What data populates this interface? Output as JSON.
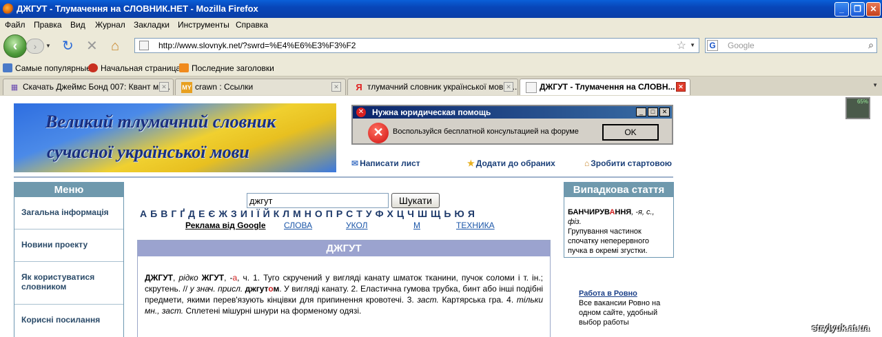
{
  "window": {
    "title": "ДЖГУТ - Тлумачення на СЛОВНИК.НЕТ - Mozilla Firefox"
  },
  "menubar": [
    "Файл",
    "Правка",
    "Вид",
    "Журнал",
    "Закладки",
    "Инструменты",
    "Справка"
  ],
  "navbar": {
    "url": "http://www.slovnyk.net/?swrd=%E4%E6%E3%F3%F2",
    "search_placeholder": "Google"
  },
  "bookmarks": [
    "Самые популярные",
    "Начальная страница",
    "Последние заголовки"
  ],
  "tabs": [
    {
      "label": "Скачать Джеймс Бонд 007: Квант ми..."
    },
    {
      "label": "crawn : Ссылки"
    },
    {
      "label": "тлумачний словник української мови ..."
    },
    {
      "label": "ДЖГУТ - Тлумачення на СЛОВН..."
    }
  ],
  "banner": {
    "line1": "Великий тлумачний словник",
    "line2": "сучасної української мови"
  },
  "ad_dialog": {
    "title": "Нужна юридическая помощь",
    "message": "Воспользуйся бесплатной консультацией на форуме",
    "ok": "OK"
  },
  "actions": [
    "Написати лист",
    "Додати до обраних",
    "Зробити стартовою"
  ],
  "menu": {
    "title": "Меню",
    "items": [
      "Загальна інформація",
      "Новини проекту",
      "Як користуватися словником",
      "Корисні посилання"
    ]
  },
  "search": {
    "value": "джгут",
    "button": "Шукати"
  },
  "alphabet": [
    "А",
    "Б",
    "В",
    "Г",
    "Ґ",
    "Д",
    "Е",
    "Є",
    "Ж",
    "З",
    "И",
    "І",
    "Ї",
    "Й",
    "К",
    "Л",
    "М",
    "Н",
    "О",
    "П",
    "Р",
    "С",
    "Т",
    "У",
    "Ф",
    "Х",
    "Ц",
    "Ч",
    "Ш",
    "Щ",
    "Ь",
    "Ю",
    "Я"
  ],
  "ads": {
    "google": "Реклама від Google",
    "links": [
      "СЛОВА",
      "УКОЛ",
      "М",
      "ТЕХНИКА"
    ]
  },
  "article": {
    "title": "ДЖГУТ",
    "headword": "ДЖГУТ",
    "text_1": ", ",
    "variant_label": "рідко",
    "variant": " ЖГУТ",
    "text_2": ", -",
    "ending_red": "а",
    "text_3": ", ч. 1. Туго скручений у вигляді канату шматок тканини, пучок соломи і т. ін.; скрутень. // ",
    "usage_label": "у знач. присл.",
    "form_pre": " джгут",
    "form_stress": "о",
    "form_post": "м",
    "text_4": ". У вигляді канату. 2. Еластична гумова трубка, бинт або інші подібні предмети, якими перев'язують кінцівки для припинення кровотечі. 3. ",
    "label_3": "заст.",
    "text_5": " Картярська гра. 4. ",
    "label_4": "тільки мн., заст.",
    "text_6": " Сплетені мішурні шнури на форменому одязі."
  },
  "random_article": {
    "title": "Випадкова стаття",
    "word_pre": "БАНЧИРУВ",
    "word_stress": "А",
    "word_post": "ННЯ",
    "grammar": ", -я, с., фіз.",
    "definition": "Групування частинок спочатку неперервного пучка в окремі згустки."
  },
  "job_ad": {
    "title": "Работа в Ровно",
    "text": "Все вакансии Ровно на одном сайте, удобный выбор работы"
  },
  "meter": {
    "value": "65%"
  },
  "watermark": "strylyuk.at.ua",
  "colors": {
    "menu_header": "#6f99ad",
    "article_header": "#9ba3cf",
    "link": "#1a3f78"
  }
}
